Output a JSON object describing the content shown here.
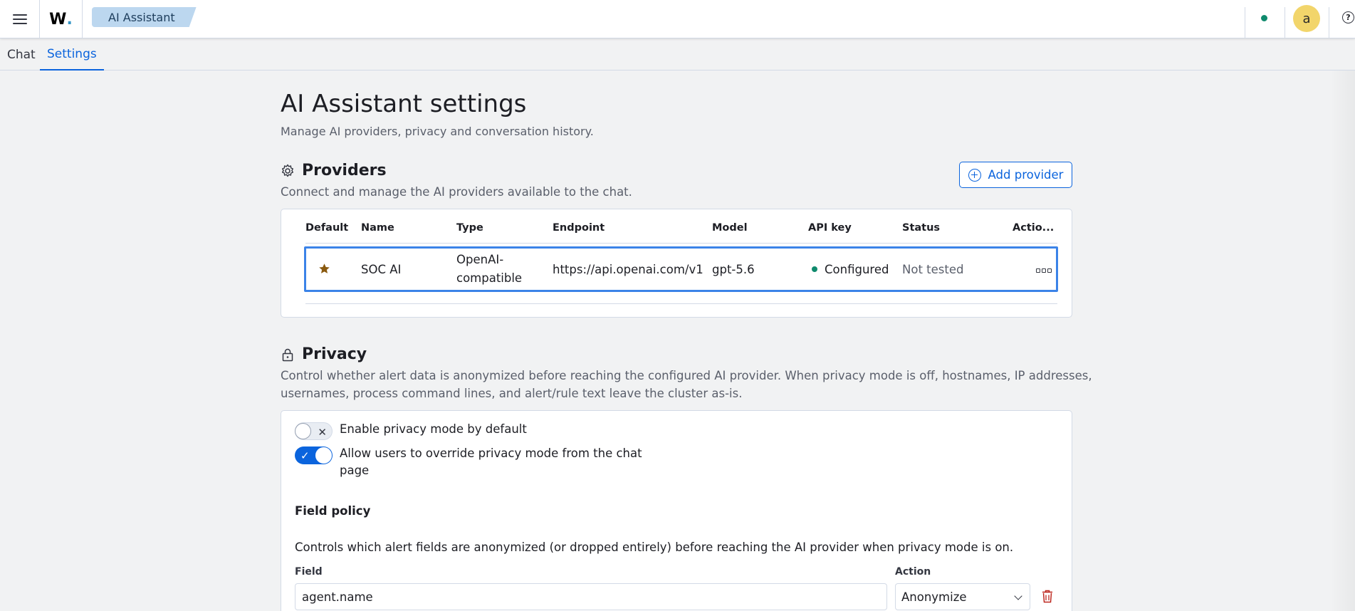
{
  "header": {
    "app_badge": "AI Assistant",
    "avatar_initial": "a",
    "logo_text": "W",
    "logo_dot": ".",
    "help_symbol": "?"
  },
  "tabs": [
    {
      "label": "Chat",
      "active": false
    },
    {
      "label": "Settings",
      "active": true
    }
  ],
  "page": {
    "title": "AI Assistant settings",
    "subtitle": "Manage AI providers, privacy and conversation history."
  },
  "providers": {
    "title": "Providers",
    "description": "Connect and manage the AI providers available to the chat.",
    "add_button": "Add provider",
    "columns": [
      "Default",
      "Name",
      "Type",
      "Endpoint",
      "Model",
      "API key",
      "Status",
      "Actio..."
    ],
    "rows": [
      {
        "default": true,
        "name": "SOC AI",
        "type_line1": "OpenAI-",
        "type_line2": "compatible",
        "endpoint": "https://api.openai.com/v1",
        "model": "gpt-5.6",
        "api_key": "Configured",
        "status": "Not tested"
      }
    ]
  },
  "privacy": {
    "title": "Privacy",
    "description_line1": "Control whether alert data is anonymized before reaching the configured AI provider. When privacy mode is off, hostnames, IP addresses,",
    "description_line2": "usernames, process command lines, and alert/rule text leave the cluster as-is.",
    "toggles": [
      {
        "label_line1": "Enable privacy mode by default",
        "label_line2": "",
        "checked": false
      },
      {
        "label_line1": "Allow users to override privacy mode from the chat",
        "label_line2": "page",
        "checked": true
      }
    ],
    "field_policy": {
      "title": "Field policy",
      "description": "Controls which alert fields are anonymized (or dropped entirely) before reaching the AI provider when privacy mode is on.",
      "field_label": "Field",
      "action_label": "Action",
      "field_value": "agent.name",
      "action_value": "Anonymize"
    }
  },
  "colors": {
    "accent": "#0b64dd",
    "status_ok": "#0f8a6d",
    "highlight_border": "#3b83e8",
    "star": "#8a5a10",
    "danger": "#bd271e"
  }
}
